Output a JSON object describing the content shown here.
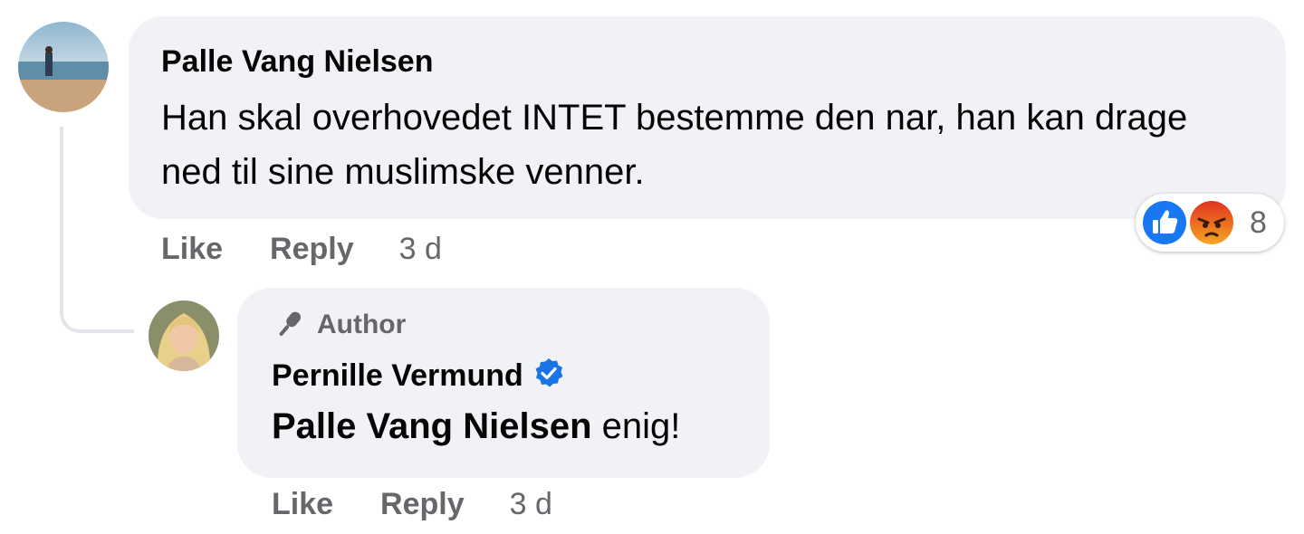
{
  "comment": {
    "author": "Palle Vang Nielsen",
    "text": "Han skal overhovedet INTET bestemme den nar, han kan drage ned til sine muslimske venner.",
    "actions": {
      "like": "Like",
      "reply": "Reply",
      "time": "3 d"
    },
    "reactions": {
      "icons": [
        "like-icon",
        "angry-icon"
      ],
      "count": "8"
    }
  },
  "reply": {
    "badge": "Author",
    "author": "Pernille Vermund",
    "verified": true,
    "mention": "Palle Vang Nielsen",
    "text": " enig!",
    "actions": {
      "like": "Like",
      "reply": "Reply",
      "time": "3 d"
    }
  },
  "colors": {
    "bubble": "#f0f2f5",
    "secondary_text": "#65676b",
    "like_blue": "#1877f2",
    "angry_orange": "#f0641e",
    "verified_blue": "#1b74e4"
  }
}
